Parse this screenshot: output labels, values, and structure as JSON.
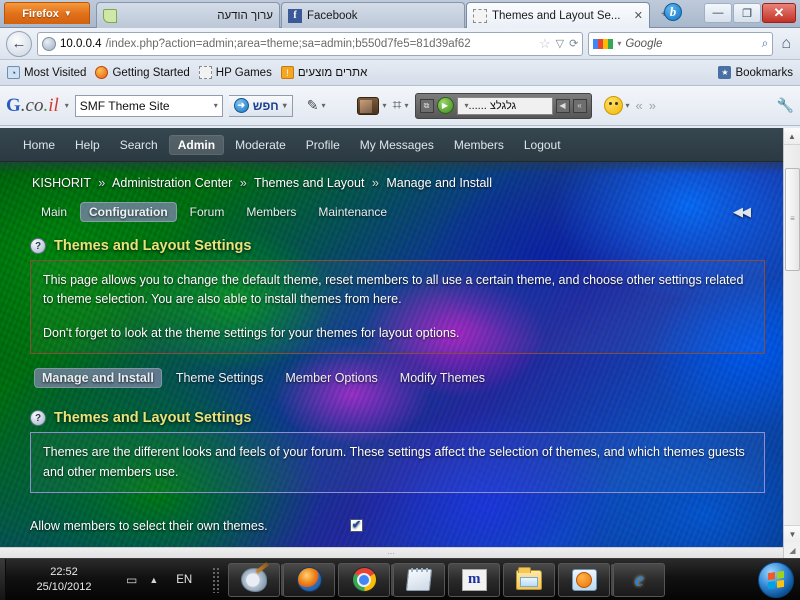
{
  "browser": {
    "firefox_button": "Firefox",
    "tabs": [
      {
        "label": "ערוך הודעה",
        "icon": "note-icon",
        "active": false
      },
      {
        "label": "Facebook",
        "icon": "facebook-icon",
        "active": false
      },
      {
        "label": "Themes and Layout Se...",
        "icon": "dotted-page-icon",
        "active": true
      }
    ],
    "new_tab_label": "+",
    "window_controls": {
      "minimize": "—",
      "restore": "❐",
      "close": "✕"
    },
    "back_arrow": "←",
    "url": {
      "host": "10.0.0.4",
      "path": "/index.php?action=admin;area=theme;sa=admin;b550d7fe5=81d39af62"
    },
    "url_actions": {
      "bookmark_star": "☆",
      "dropdown": "▽",
      "reload": "⟳"
    },
    "search": {
      "engine": "Google",
      "placeholder": "Google",
      "magnifier": "⌕"
    },
    "home_label": "⌂",
    "bookmarks": [
      {
        "label": "Most Visited",
        "icon": "most-visited-icon"
      },
      {
        "label": "Getting Started",
        "icon": "firefox-icon"
      },
      {
        "label": "HP Games",
        "icon": "dotted-page-icon"
      },
      {
        "label": "אתרים מוצעים",
        "icon": "bulb-icon"
      }
    ],
    "bookmarks_menu_label": "Bookmarks",
    "google_toolbar": {
      "logo": "G.co.il",
      "search_value": "SMF Theme Site",
      "search_button": "חפש",
      "radio_station": "גלגלצ ......",
      "caret": "▾",
      "prev_label": "«",
      "next_label": "»",
      "wrench": "🔧"
    }
  },
  "forum": {
    "nav": [
      {
        "label": "Home",
        "active": false
      },
      {
        "label": "Help",
        "active": false
      },
      {
        "label": "Search",
        "active": false
      },
      {
        "label": "Admin",
        "active": true
      },
      {
        "label": "Moderate",
        "active": false
      },
      {
        "label": "Profile",
        "active": false
      },
      {
        "label": "My Messages",
        "active": false
      },
      {
        "label": "Members",
        "active": false
      },
      {
        "label": "Logout",
        "active": false
      }
    ],
    "breadcrumb": [
      "KISHORIT",
      "Administration Center",
      "Themes and Layout",
      "Manage and Install"
    ],
    "breadcrumb_separator": "»",
    "admin_tabs": [
      {
        "label": "Main",
        "active": false
      },
      {
        "label": "Configuration",
        "active": true
      },
      {
        "label": "Forum",
        "active": false
      },
      {
        "label": "Members",
        "active": false
      },
      {
        "label": "Maintenance",
        "active": false
      }
    ],
    "collapse_arrows": "◀◀",
    "section_one": {
      "title": "Themes and Layout Settings",
      "help_icon": "?",
      "paragraph_1": "This page allows you to change the default theme, reset members to all use a certain theme, and choose other settings related to theme selection. You are also able to install themes from here.",
      "paragraph_2": "Don't forget to look at the theme settings for your themes for layout options."
    },
    "sub_tabs": [
      {
        "label": "Manage and Install",
        "active": true
      },
      {
        "label": "Theme Settings",
        "active": false
      },
      {
        "label": "Member Options",
        "active": false
      },
      {
        "label": "Modify Themes",
        "active": false
      }
    ],
    "section_two": {
      "title": "Themes and Layout Settings",
      "help_icon": "?",
      "paragraph_1": "Themes are the different looks and feels of your forum. These settings affect the selection of themes, and which themes guests and other members use."
    },
    "settings": [
      {
        "label": "Allow members to select their own themes.",
        "checked": true,
        "check_glyph": "✔"
      }
    ]
  },
  "scrollbar": {
    "up": "▲",
    "down": "▼",
    "grip": "≡",
    "corner": "◢",
    "h_grip": "⋯"
  },
  "taskbar": {
    "time": "22:52",
    "date": "25/10/2012",
    "language": "EN",
    "tray_show_desktop": "▭",
    "tray_expand": "▲",
    "apps": [
      {
        "name": "paint-taskbar-icon"
      },
      {
        "name": "firefox-taskbar-icon"
      },
      {
        "name": "chrome-taskbar-icon"
      },
      {
        "name": "notepad-taskbar-icon"
      },
      {
        "name": "mirc-taskbar-icon"
      },
      {
        "name": "explorer-taskbar-icon"
      },
      {
        "name": "media-player-taskbar-icon"
      },
      {
        "name": "internet-explorer-taskbar-icon"
      }
    ],
    "start_label": "Start"
  },
  "colors": {
    "accent_yellow": "#e8e37a",
    "firefox_orange": "#e2711a",
    "nav_dark": "#37474f"
  }
}
